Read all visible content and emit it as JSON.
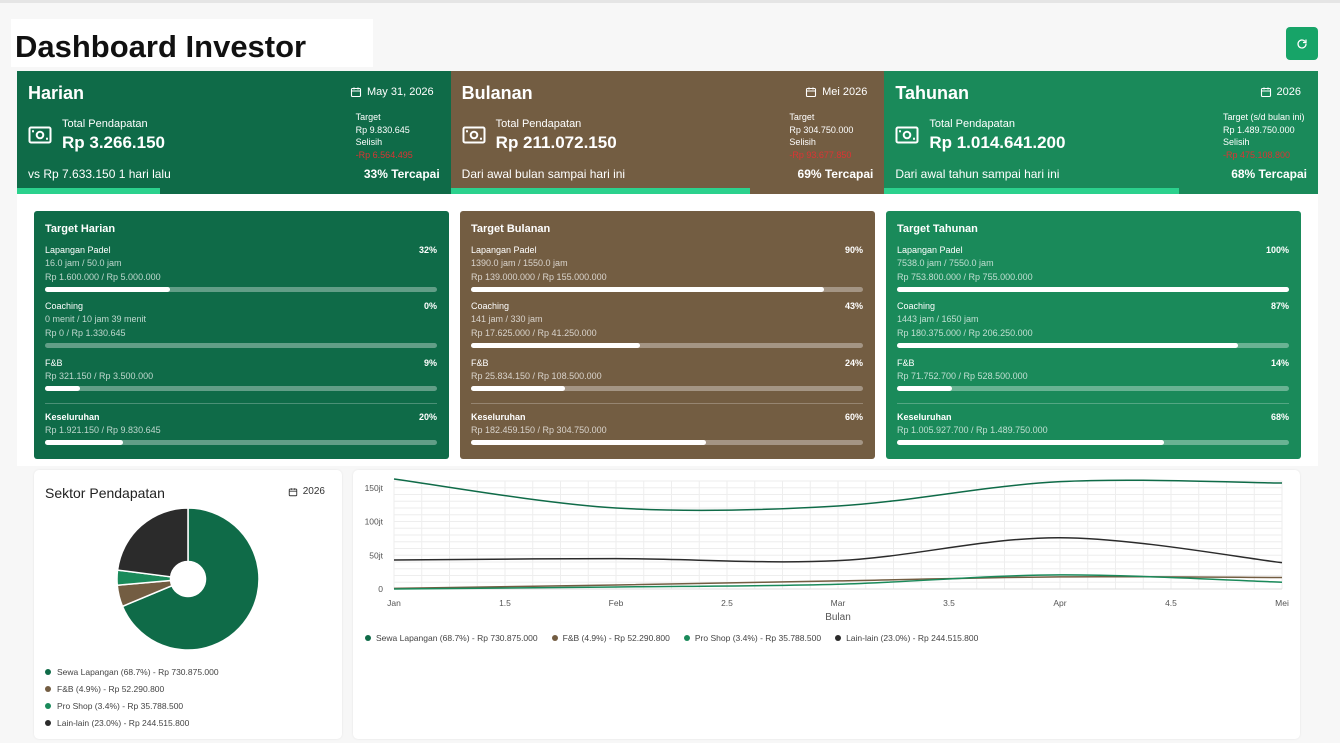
{
  "header": {
    "title": "Dashboard Investor"
  },
  "colors": {
    "dark_green": "#0f6b48",
    "brown": "#735d42",
    "mid_green": "#1a8a5a",
    "accent": "#2bd18d",
    "negative": "#dd3333",
    "refresh": "#17a468"
  },
  "summary": [
    {
      "title": "Harian",
      "date": "May 31, 2026",
      "total_label": "Total Pendapatan",
      "total_value": "Rp 3.266.150",
      "target_label": "Target",
      "target_value": "Rp 9.830.645",
      "diff_label": "Selisih",
      "diff_value": "-Rp 6.564.495",
      "footer": "vs Rp 7.633.150 1 hari lalu",
      "pct_text": "33% Tercapai",
      "progress": 0.33
    },
    {
      "title": "Bulanan",
      "date": "Mei 2026",
      "total_label": "Total Pendapatan",
      "total_value": "Rp 211.072.150",
      "target_label": "Target",
      "target_value": "Rp 304.750.000",
      "diff_label": "Selisih",
      "diff_value": "-Rp 93.677.850",
      "footer": "Dari awal bulan sampai hari ini",
      "pct_text": "69% Tercapai",
      "progress": 0.69
    },
    {
      "title": "Tahunan",
      "date": "2026",
      "total_label": "Total Pendapatan",
      "total_value": "Rp 1.014.641.200",
      "target_label": "Target (s/d bulan ini)",
      "target_value": "Rp 1.489.750.000",
      "diff_label": "Selisih",
      "diff_value": "-Rp 475.108.800",
      "footer": "Dari awal tahun sampai hari ini",
      "pct_text": "68% Tercapai",
      "progress": 0.68
    }
  ],
  "targets": [
    {
      "title": "Target Harian",
      "items": [
        {
          "label": "Lapangan Padel",
          "pct": "32%",
          "sub1": "16.0 jam / 50.0 jam",
          "sub2": "Rp 1.600.000 / Rp 5.000.000",
          "progress": 0.32
        },
        {
          "label": "Coaching",
          "pct": "0%",
          "sub1": "0 menit / 10 jam 39 menit",
          "sub2": "Rp 0 / Rp 1.330.645",
          "progress": 0.0
        },
        {
          "label": "F&B",
          "pct": "9%",
          "sub1": "",
          "sub2": "Rp 321.150 / Rp 3.500.000",
          "progress": 0.09
        },
        {
          "label": "Keseluruhan",
          "pct": "20%",
          "sub1": "",
          "sub2": "Rp 1.921.150 / Rp 9.830.645",
          "progress": 0.2
        }
      ]
    },
    {
      "title": "Target Bulanan",
      "items": [
        {
          "label": "Lapangan Padel",
          "pct": "90%",
          "sub1": "1390.0 jam / 1550.0 jam",
          "sub2": "Rp 139.000.000 / Rp 155.000.000",
          "progress": 0.9
        },
        {
          "label": "Coaching",
          "pct": "43%",
          "sub1": "141 jam / 330 jam",
          "sub2": "Rp 17.625.000 / Rp 41.250.000",
          "progress": 0.43
        },
        {
          "label": "F&B",
          "pct": "24%",
          "sub1": "",
          "sub2": "Rp 25.834.150 / Rp 108.500.000",
          "progress": 0.24
        },
        {
          "label": "Keseluruhan",
          "pct": "60%",
          "sub1": "",
          "sub2": "Rp 182.459.150 / Rp 304.750.000",
          "progress": 0.6
        }
      ]
    },
    {
      "title": "Target Tahunan",
      "items": [
        {
          "label": "Lapangan Padel",
          "pct": "100%",
          "sub1": "7538.0 jam / 7550.0 jam",
          "sub2": "Rp 753.800.000 / Rp 755.000.000",
          "progress": 1.0
        },
        {
          "label": "Coaching",
          "pct": "87%",
          "sub1": "1443 jam / 1650 jam",
          "sub2": "Rp 180.375.000 / Rp 206.250.000",
          "progress": 0.87
        },
        {
          "label": "F&B",
          "pct": "14%",
          "sub1": "",
          "sub2": "Rp 71.752.700 / Rp 528.500.000",
          "progress": 0.14
        },
        {
          "label": "Keseluruhan",
          "pct": "68%",
          "sub1": "",
          "sub2": "Rp 1.005.927.700 / Rp 1.489.750.000",
          "progress": 0.68
        }
      ]
    }
  ],
  "sector": {
    "title": "Sektor Pendapatan",
    "year": "2026",
    "legend": [
      {
        "text": "Sewa Lapangan (68.7%) - Rp 730.875.000",
        "color": "#0f6b48"
      },
      {
        "text": "F&B (4.9%) - Rp 52.290.800",
        "color": "#735d42"
      },
      {
        "text": "Pro Shop (3.4%) - Rp 35.788.500",
        "color": "#1a8a5a"
      },
      {
        "text": "Lain-lain (23.0%) - Rp 244.515.800",
        "color": "#2b2b2b"
      }
    ]
  },
  "chart_data": [
    {
      "type": "pie",
      "categories": [
        "Sewa Lapangan",
        "F&B",
        "Pro Shop",
        "Lain-lain"
      ],
      "values": [
        68.7,
        4.9,
        3.4,
        23.0
      ],
      "colors": [
        "#0f6b48",
        "#735d42",
        "#1a8a5a",
        "#2b2b2b"
      ],
      "donut": true
    },
    {
      "type": "line",
      "x": [
        1,
        1.5,
        2,
        2.5,
        3,
        3.5,
        4,
        4.5,
        5
      ],
      "x_tick_labels": [
        "Jan",
        "1.5",
        "Feb",
        "2.5",
        "Mar",
        "3.5",
        "Apr",
        "4.5",
        "Mei"
      ],
      "xlabel": "Bulan",
      "ylabel": "",
      "y_ticks": [
        0,
        50,
        100,
        150
      ],
      "y_tick_labels": [
        "0",
        "50jt",
        "100jt",
        "150jt"
      ],
      "ylim": [
        0,
        160
      ],
      "xlim": [
        1,
        5
      ],
      "grid": true,
      "legend_position": "bottom",
      "series": [
        {
          "name": "Sewa Lapangan (68.7%) - Rp 730.875.000",
          "color": "#0f6b48",
          "x": [
            1,
            2,
            3,
            4,
            5
          ],
          "values": [
            163,
            120,
            123,
            159,
            157
          ]
        },
        {
          "name": "F&B (4.9%) - Rp 52.290.800",
          "color": "#735d42",
          "x": [
            1,
            2,
            3,
            4,
            5
          ],
          "values": [
            1,
            6,
            12,
            18,
            17
          ]
        },
        {
          "name": "Pro Shop (3.4%) - Rp 35.788.500",
          "color": "#1a8a5a",
          "x": [
            1,
            2,
            3,
            4,
            5
          ],
          "values": [
            0,
            3,
            7,
            21,
            10
          ]
        },
        {
          "name": "Lain-lain (23.0%) - Rp 244.515.800",
          "color": "#2b2b2b",
          "x": [
            1,
            2,
            3,
            4,
            5
          ],
          "values": [
            43,
            45,
            42,
            76,
            39
          ]
        }
      ]
    }
  ]
}
